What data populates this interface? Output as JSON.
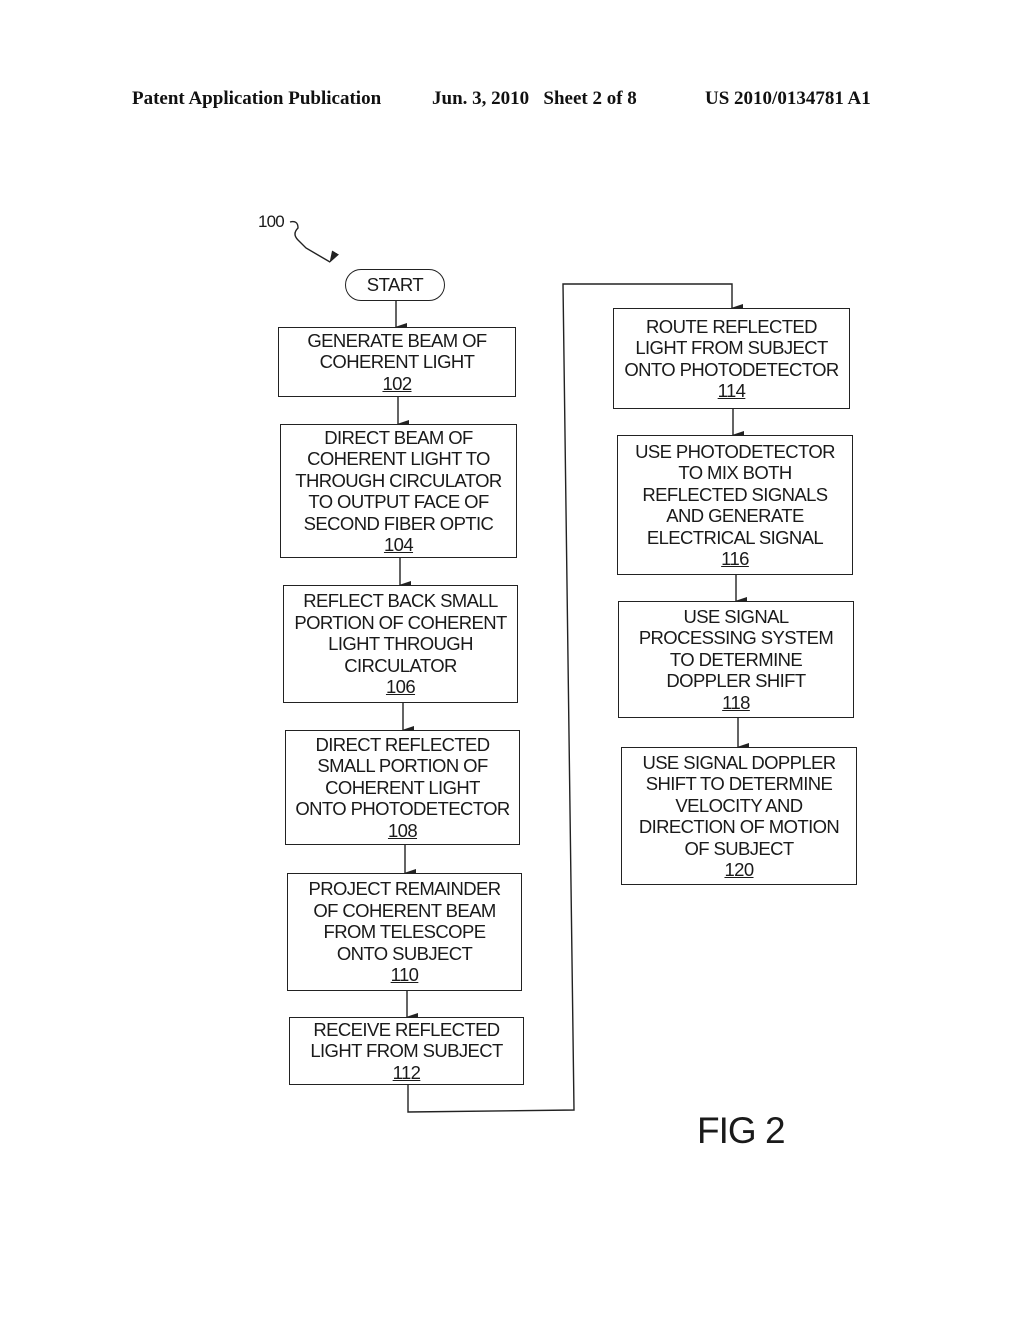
{
  "header": {
    "publication": "Patent Application Publication",
    "date_sheet": "Jun. 3, 2010   Sheet 2 of 8",
    "patent_number": "US 2010/0134781 A1"
  },
  "diagram": {
    "reference_label": "100",
    "start_label": "START",
    "figure_label": "FIG 2",
    "steps": [
      {
        "lines": [
          "GENERATE BEAM OF",
          "COHERENT LIGHT"
        ],
        "ref": "102"
      },
      {
        "lines": [
          "DIRECT BEAM OF",
          "COHERENT LIGHT TO",
          "THROUGH CIRCULATOR",
          "TO OUTPUT FACE OF",
          "SECOND FIBER OPTIC"
        ],
        "ref": "104"
      },
      {
        "lines": [
          "REFLECT BACK SMALL",
          "PORTION OF COHERENT",
          "LIGHT THROUGH",
          "CIRCULATOR"
        ],
        "ref": "106"
      },
      {
        "lines": [
          "DIRECT REFLECTED",
          "SMALL PORTION OF",
          "COHERENT LIGHT",
          "ONTO PHOTODETECTOR"
        ],
        "ref": "108"
      },
      {
        "lines": [
          "PROJECT REMAINDER",
          "OF COHERENT BEAM",
          "FROM TELESCOPE",
          "ONTO SUBJECT"
        ],
        "ref": "110"
      },
      {
        "lines": [
          "RECEIVE REFLECTED",
          "LIGHT FROM SUBJECT"
        ],
        "ref": "112"
      },
      {
        "lines": [
          "ROUTE REFLECTED",
          "LIGHT FROM SUBJECT",
          "ONTO PHOTODETECTOR"
        ],
        "ref": "114"
      },
      {
        "lines": [
          "USE PHOTODETECTOR",
          "TO MIX BOTH",
          "REFLECTED SIGNALS",
          "AND GENERATE",
          "ELECTRICAL SIGNAL"
        ],
        "ref": "116"
      },
      {
        "lines": [
          "USE SIGNAL",
          "PROCESSING SYSTEM",
          "TO DETERMINE",
          "DOPPLER SHIFT"
        ],
        "ref": "118"
      },
      {
        "lines": [
          "USE SIGNAL DOPPLER",
          "SHIFT TO DETERMINE",
          "VELOCITY AND",
          "DIRECTION OF MOTION",
          "OF SUBJECT"
        ],
        "ref": "120"
      }
    ]
  }
}
